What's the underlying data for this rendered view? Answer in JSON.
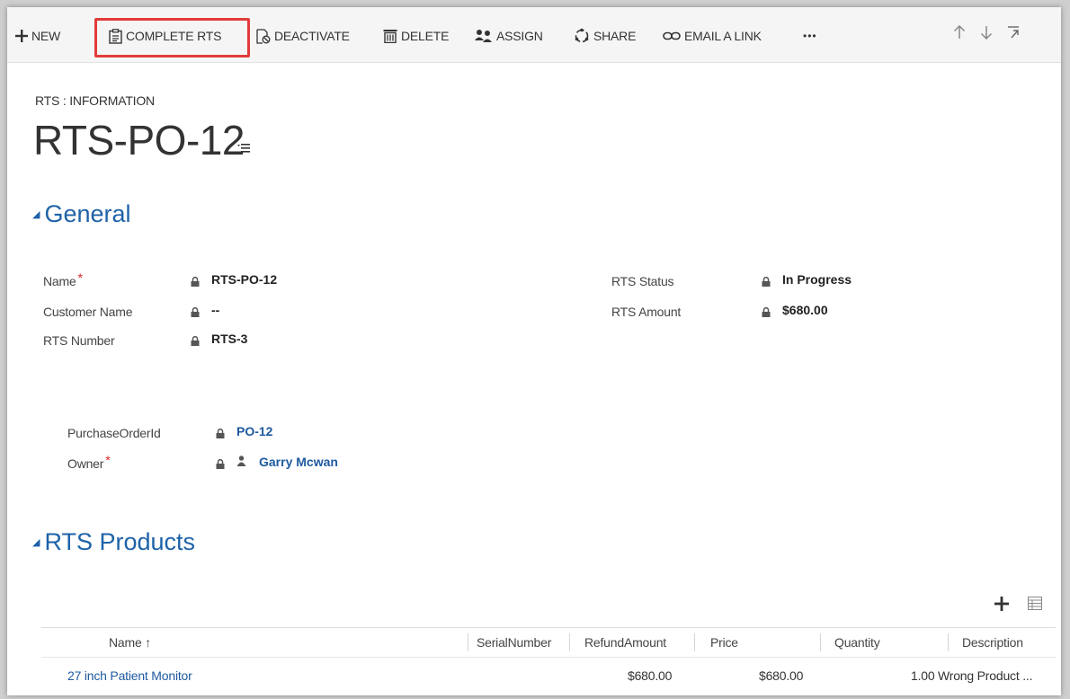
{
  "toolbar": {
    "new_label": "NEW",
    "complete_label": "COMPLETE RTS",
    "deactivate_label": "DEACTIVATE",
    "delete_label": "DELETE",
    "assign_label": "ASSIGN",
    "share_label": "SHARE",
    "email_label": "EMAIL A LINK",
    "more_label": "•••",
    "up_icon": "arrow-up-icon",
    "down_icon": "arrow-down-icon",
    "popout_icon": "popout-icon",
    "highlight_color": "#e23b3b"
  },
  "header": {
    "entity_label": "RTS : INFORMATION",
    "record_title": "RTS-PO-12"
  },
  "general": {
    "title": "General",
    "fields": {
      "name_label": "Name",
      "name_value": "RTS-PO-12",
      "customer_label": "Customer Name",
      "customer_value": "--",
      "rts_number_label": "RTS Number",
      "rts_number_value": "RTS-3",
      "rts_status_label": "RTS Status",
      "rts_status_value": "In Progress",
      "rts_amount_label": "RTS Amount",
      "rts_amount_value": "$680.00",
      "po_label": "PurchaseOrderId",
      "po_value": "PO-12",
      "owner_label": "Owner",
      "owner_value": "Garry Mcwan",
      "required_marker": "*"
    }
  },
  "products": {
    "title": "RTS Products",
    "columns": {
      "name": "Name ↑",
      "serial": "SerialNumber",
      "refund": "RefundAmount",
      "price": "Price",
      "quantity": "Quantity",
      "description": "Description"
    },
    "rows": [
      {
        "name": "27 inch Patient Monitor",
        "serial": "",
        "refund": "$680.00",
        "price": "$680.00",
        "quantity": "1.00",
        "description": "Wrong Product ..."
      }
    ]
  },
  "colors": {
    "accent": "#1e62a8",
    "link": "#1e5aa0",
    "required": "#e02020"
  }
}
